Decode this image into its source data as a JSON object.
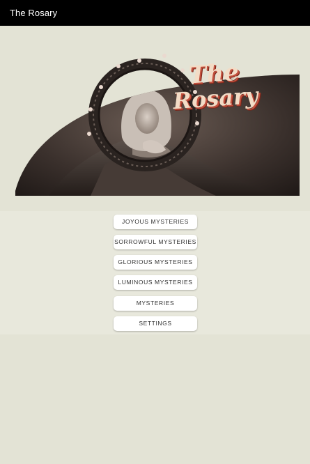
{
  "app_bar": {
    "title": "The Rosary"
  },
  "hero": {
    "title_line1": "The",
    "title_line2": "Rosary",
    "image_subject": "madonna-with-halo-image"
  },
  "menu": {
    "items": [
      {
        "label": "JOYOUS MYSTERIES"
      },
      {
        "label": "SORROWFUL MYSTERIES"
      },
      {
        "label": "GLORIOUS MYSTERIES"
      },
      {
        "label": "LUMINOUS MYSTERIES"
      },
      {
        "label": "MYSTERIES"
      },
      {
        "label": "SETTINGS"
      }
    ]
  },
  "colors": {
    "app_bar": "#000000",
    "background": "#e3e3d5",
    "button": "#ffffff",
    "title_fill": "#f3dcc6",
    "title_shadow": "#c2503d"
  }
}
